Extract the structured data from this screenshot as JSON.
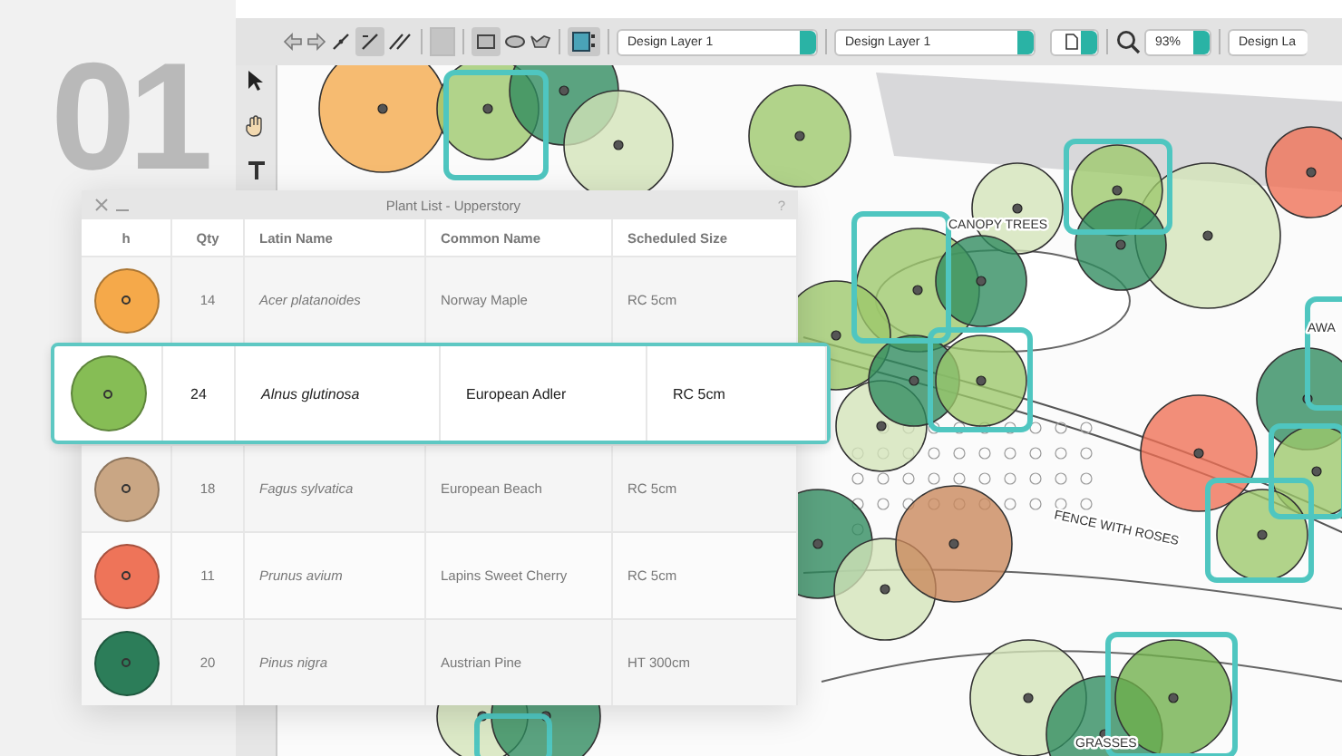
{
  "backdrop": {
    "number": "01"
  },
  "toolbar": {
    "class_dropdown": "Design Layer 1",
    "layer_dropdown": "Design Layer 1",
    "zoom": "93%",
    "view_dropdown": "Design La"
  },
  "canvas": {
    "labels": [
      {
        "text": "CANOPY TREES"
      },
      {
        "text": "FENCE WITH ROSES"
      },
      {
        "text": "GRASSES"
      },
      {
        "text": "AWA"
      }
    ]
  },
  "plant_list": {
    "title": "Plant List - Upperstory",
    "help": "?",
    "columns": [
      "h",
      "Qty",
      "Latin Name",
      "Common Name",
      "Scheduled Size"
    ],
    "rows": [
      {
        "color": "#f5a94a",
        "qty": "14",
        "latin": "Acer platanoides",
        "common": "Norway Maple",
        "size": "RC 5cm",
        "selected": false
      },
      {
        "color": "#86bd55",
        "qty": "24",
        "latin": "Alnus glutinosa",
        "common": "European Adler",
        "size": "RC 5cm",
        "selected": true
      },
      {
        "color": "#c9a684",
        "qty": "18",
        "latin": "Fagus sylvatica",
        "common": "European Beach",
        "size": "RC 5cm",
        "selected": false
      },
      {
        "color": "#ee7459",
        "qty": "11",
        "latin": "Prunus avium",
        "common": "Lapins Sweet Cherry",
        "size": "RC 5cm",
        "selected": false
      },
      {
        "color": "#2c7d59",
        "qty": "20",
        "latin": "Pinus nigra",
        "common": "Austrian Pine",
        "size": "HT 300cm",
        "selected": false
      }
    ]
  }
}
